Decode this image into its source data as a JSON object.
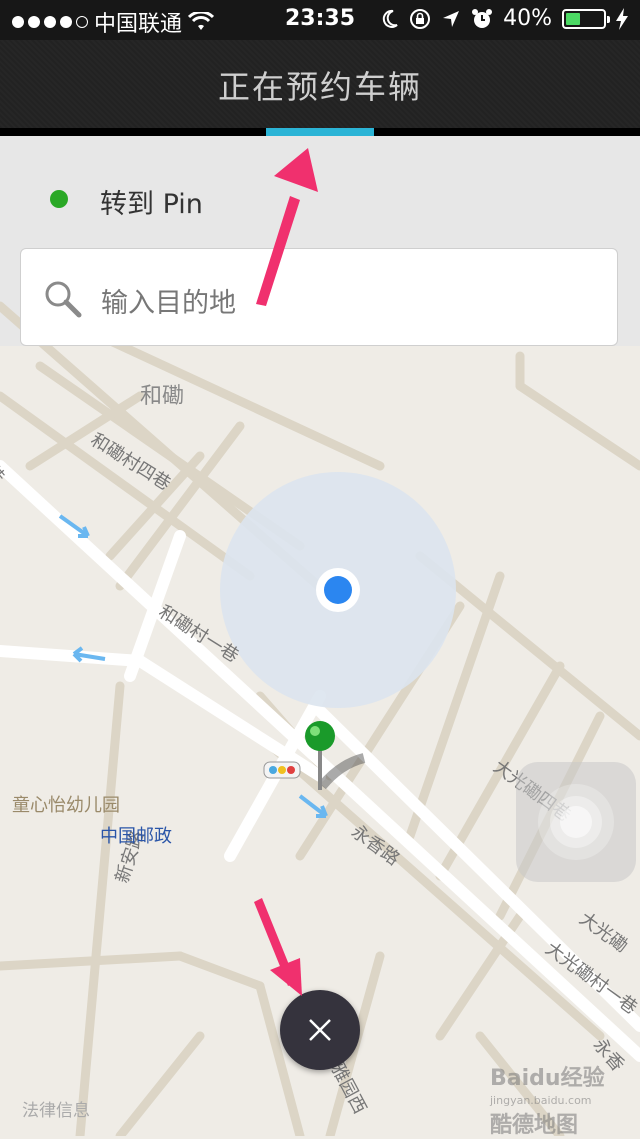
{
  "status_bar": {
    "carrier": "中国联通",
    "time": "23:35",
    "battery_percent": "40%",
    "battery_level": 0.4,
    "icons": [
      "signal-dots-icon",
      "wifi-icon",
      "moon-icon",
      "rotation-lock-icon",
      "location-arrow-icon",
      "alarm-icon",
      "battery-icon",
      "charging-bolt-icon"
    ]
  },
  "nav": {
    "title": "正在预约车辆"
  },
  "pickup": {
    "label": "转到 Pin",
    "dot_color": "#2aa826"
  },
  "search": {
    "placeholder": "输入目的地",
    "icon": "search-icon"
  },
  "map": {
    "labels": {
      "area_hexiao": "和磡",
      "street_hexiao_4": "和磡村四巷",
      "street_hexiao_1": "和磡村一巷",
      "street_xin_an": "新安路",
      "poi_kindergarten": "童心怡幼儿园",
      "poi_post": "中国邮政",
      "street_yongxiang": "永香路",
      "street_daguang_4": "大光磡四巷",
      "street_daguang": "大光磡",
      "street_daguang_1": "大光磡村一巷",
      "street_guangya": "光雅园西",
      "street_edge_left": "巷",
      "street_edge_right": "永香"
    },
    "accuracy_color": "#dbe4ee",
    "location_color": "#2b86f0",
    "pin_color": "#1a9a2a"
  },
  "close_button": {
    "icon": "close-icon"
  },
  "footer": {
    "legal": "法律信息",
    "watermark": "Baidu经验",
    "watermark_sub": "jingyan.baidu.com",
    "watermark_2": "酷德地图"
  }
}
